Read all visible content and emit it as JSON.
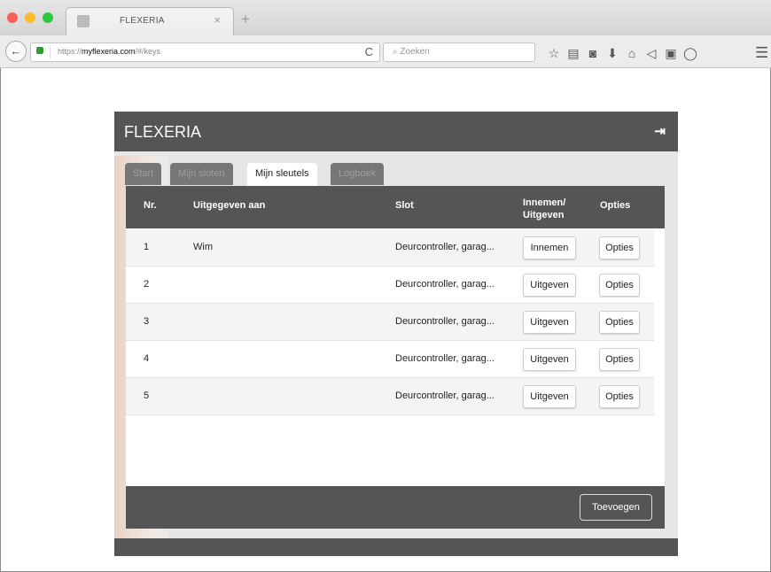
{
  "browser": {
    "tab_title": "FLEXERIA",
    "url_prefix": "https://",
    "url_domain": "myflexeria.com",
    "url_path": "/#/keys",
    "search_placeholder": "Zoeken"
  },
  "app": {
    "brand": "FLEXERIA",
    "tabs": [
      {
        "label": "Start",
        "active": false
      },
      {
        "label": "Mijn sloten",
        "active": false
      },
      {
        "label": "Mijn sleutels",
        "active": true
      },
      {
        "label": "Logboek",
        "active": false
      }
    ],
    "table": {
      "headers": {
        "nr": "Nr.",
        "issued_to": "Uitgegeven aan",
        "lock": "Slot",
        "action_line1": "Innemen/",
        "action_line2": "Uitgeven",
        "options": "Opties"
      },
      "rows": [
        {
          "nr": "1",
          "issued_to": "Wim",
          "lock": "Deurcontroller, garag...",
          "action": "Innemen",
          "options": "Opties"
        },
        {
          "nr": "2",
          "issued_to": "",
          "lock": "Deurcontroller, garag...",
          "action": "Uitgeven",
          "options": "Opties"
        },
        {
          "nr": "3",
          "issued_to": "",
          "lock": "Deurcontroller, garag...",
          "action": "Uitgeven",
          "options": "Opties"
        },
        {
          "nr": "4",
          "issued_to": "",
          "lock": "Deurcontroller, garag...",
          "action": "Uitgeven",
          "options": "Opties"
        },
        {
          "nr": "5",
          "issued_to": "",
          "lock": "Deurcontroller, garag...",
          "action": "Uitgeven",
          "options": "Opties"
        }
      ]
    },
    "add_label": "Toevoegen"
  },
  "icons": {
    "close": "×",
    "new_tab": "+",
    "back": "←",
    "reload": "C",
    "search": "⌕",
    "star": "☆",
    "reading_list": "▤",
    "pocket": "◙",
    "download": "⬇",
    "home": "⌂",
    "send": "◁",
    "pdf": "▣",
    "chat": "◯",
    "hamburger": "☰",
    "logout": "⇥"
  },
  "colors": {
    "header_bg": "#555555",
    "app_bg": "#e6e6e6"
  }
}
